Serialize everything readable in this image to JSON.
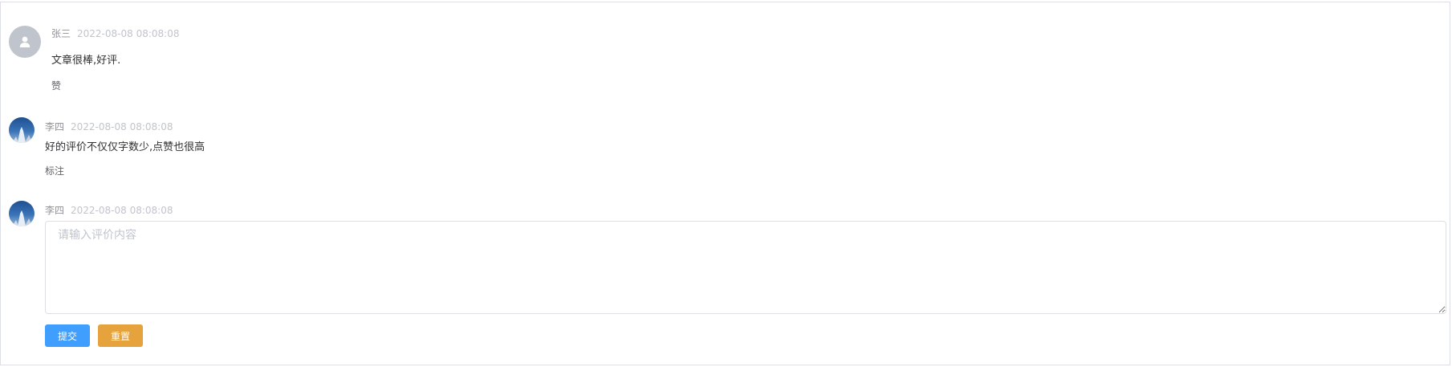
{
  "comments": [
    {
      "author": "张三",
      "time": "2022-08-08 08:08:08",
      "content": "文章很棒,好评.",
      "action": "赞",
      "avatar": "default-user-icon"
    },
    {
      "author": "李四",
      "time": "2022-08-08 08:08:08",
      "content": "好的评价不仅仅字数少,点赞也很高",
      "action": "标注",
      "avatar": "photo"
    }
  ],
  "reply": {
    "author": "李四",
    "time": "2022-08-08 08:08:08",
    "placeholder": "请输入评价内容",
    "value": "",
    "submit_label": "提交",
    "reset_label": "重置"
  },
  "colors": {
    "primary": "#409eff",
    "warning": "#e6a23c",
    "avatar_default": "#c0c4cc",
    "border": "#dcdfe6"
  }
}
